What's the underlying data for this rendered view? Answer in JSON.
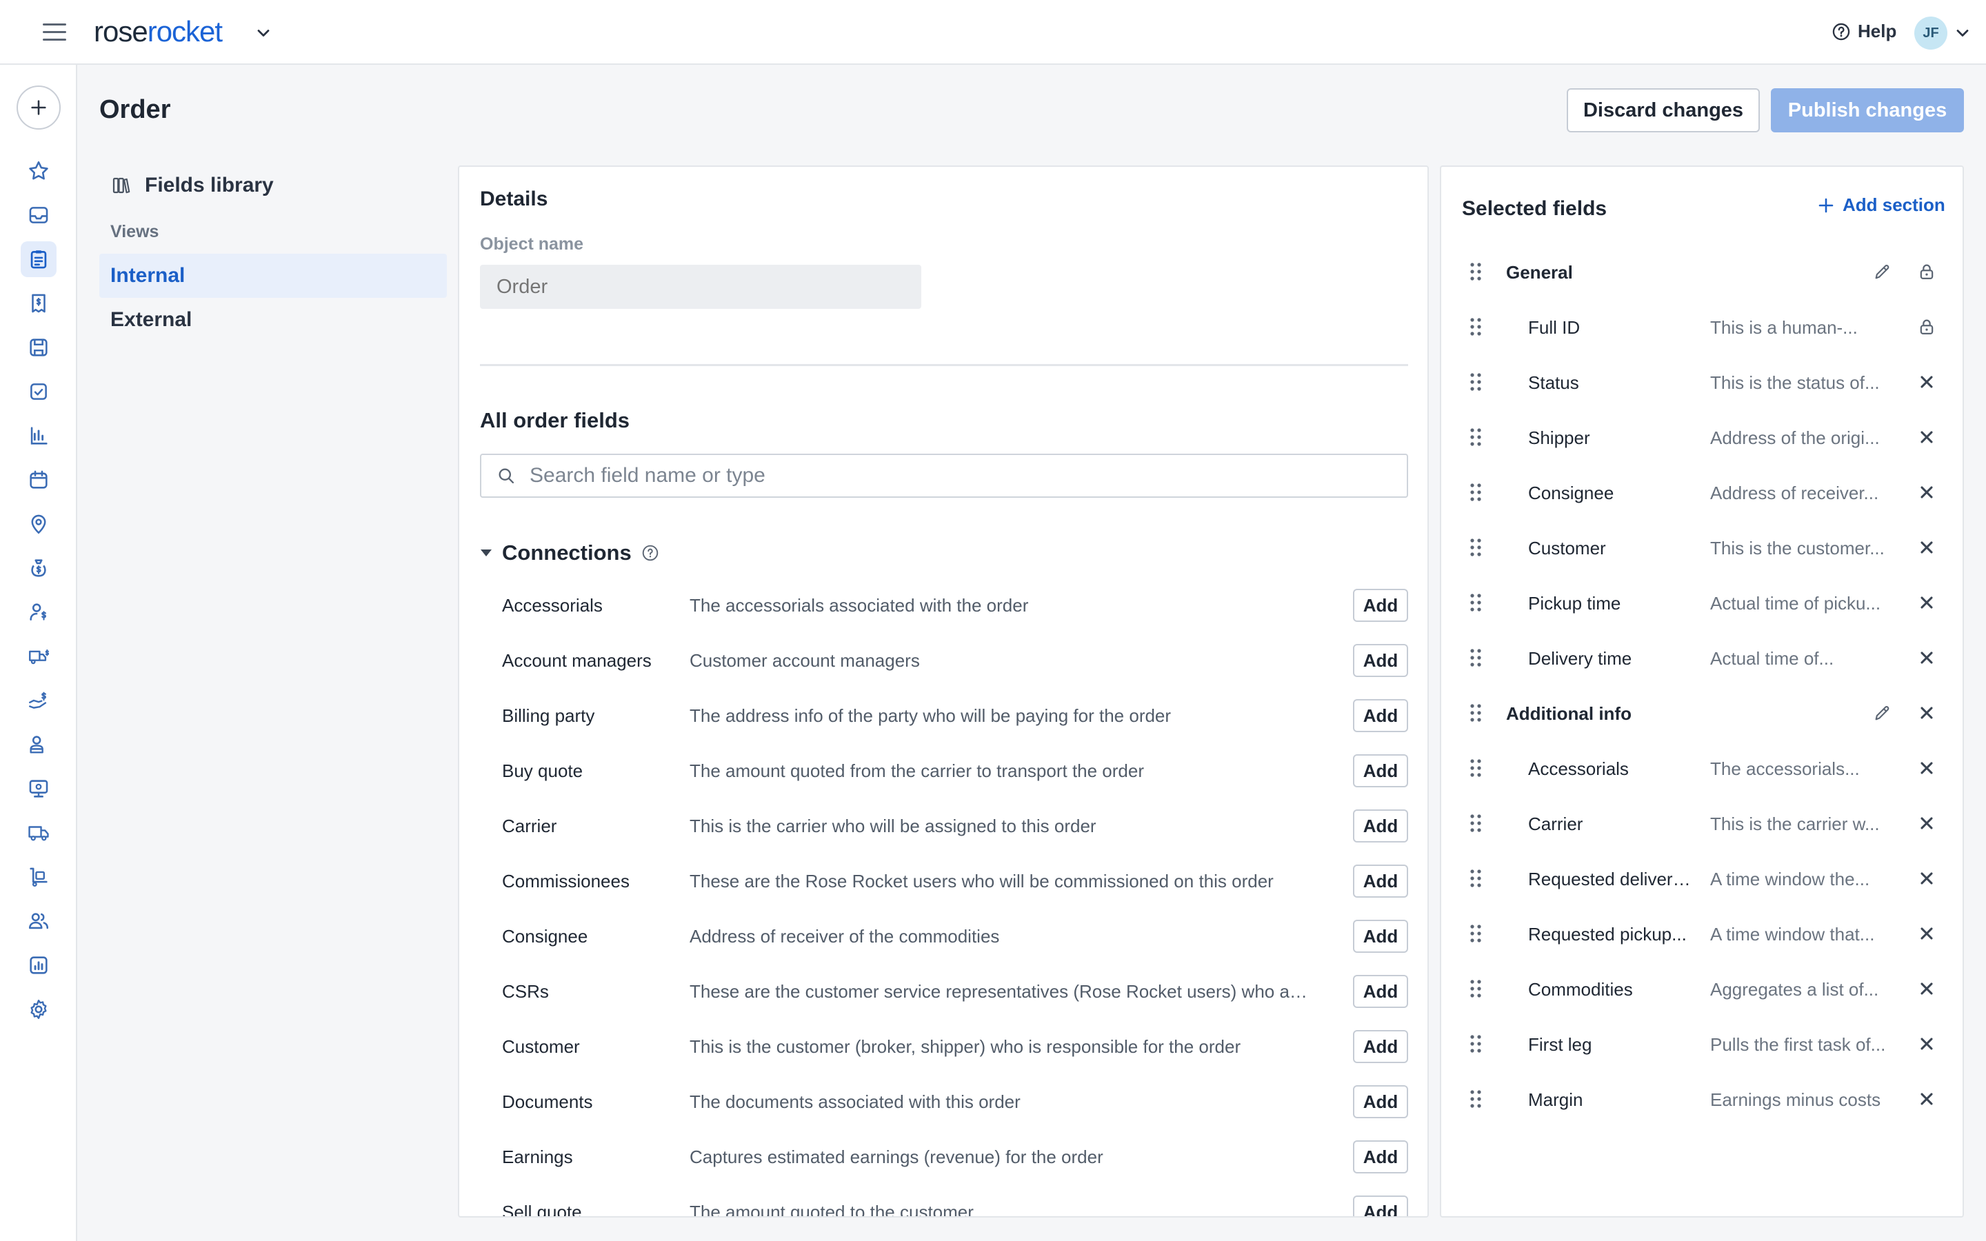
{
  "brand": {
    "name_part1": "rose",
    "name_part2": "rocket"
  },
  "header": {
    "help_label": "Help",
    "avatar_initials": "JF"
  },
  "page": {
    "title": "Order",
    "discard_label": "Discard changes",
    "publish_label": "Publish changes"
  },
  "library": {
    "title": "Fields library",
    "views_label": "Views",
    "views": [
      {
        "label": "Internal",
        "active": true
      },
      {
        "label": "External",
        "active": false
      }
    ]
  },
  "details": {
    "title": "Details",
    "object_name_label": "Object name",
    "object_name_placeholder": "Order"
  },
  "all_fields": {
    "title": "All order fields",
    "search_placeholder": "Search field name or type",
    "group_title": "Connections",
    "add_label": "Add",
    "rows": [
      {
        "name": "Accessorials",
        "desc": "The accessorials associated with the order"
      },
      {
        "name": "Account managers",
        "desc": "Customer account managers"
      },
      {
        "name": "Billing party",
        "desc": "The address info of the party who will be paying for the order"
      },
      {
        "name": "Buy quote",
        "desc": "The amount quoted from the carrier to transport the order"
      },
      {
        "name": "Carrier",
        "desc": "This is the carrier who will be assigned to this order"
      },
      {
        "name": "Commissionees",
        "desc": "These are the Rose Rocket users who will be commissioned on this order"
      },
      {
        "name": "Consignee",
        "desc": "Address of receiver of the commodities"
      },
      {
        "name": "CSRs",
        "desc": "These are the customer service representatives (Rose Rocket users) who are..."
      },
      {
        "name": "Customer",
        "desc": "This is the customer (broker, shipper) who is responsible for the order"
      },
      {
        "name": "Documents",
        "desc": "The documents associated with this order"
      },
      {
        "name": "Earnings",
        "desc": "Captures estimated earnings (revenue) for the order"
      },
      {
        "name": "Sell quote",
        "desc": "The amount quoted to the customer"
      }
    ]
  },
  "selected": {
    "title": "Selected fields",
    "add_section_label": "Add section",
    "sections": [
      {
        "name": "General",
        "fields": [
          {
            "name": "Full ID",
            "desc": "This is a human-...",
            "locked": true
          },
          {
            "name": "Status",
            "desc": "This is the status of...",
            "locked": false
          },
          {
            "name": "Shipper",
            "desc": "Address of the origi...",
            "locked": false
          },
          {
            "name": "Consignee",
            "desc": "Address of receiver...",
            "locked": false
          },
          {
            "name": "Customer",
            "desc": "This is the customer...",
            "locked": false
          },
          {
            "name": "Pickup time",
            "desc": "Actual time of picku...",
            "locked": false
          },
          {
            "name": "Delivery time",
            "desc": "Actual time of...",
            "locked": false
          }
        ]
      },
      {
        "name": "Additional info",
        "fields": [
          {
            "name": "Accessorials",
            "desc": "The accessorials...",
            "locked": false
          },
          {
            "name": "Carrier",
            "desc": "This is the carrier w...",
            "locked": false
          },
          {
            "name": "Requested delivery...",
            "desc": "A time window the...",
            "locked": false
          },
          {
            "name": "Requested pickup...",
            "desc": "A time window that...",
            "locked": false
          },
          {
            "name": "Commodities",
            "desc": "Aggregates a list of...",
            "locked": false
          },
          {
            "name": "First leg",
            "desc": "Pulls the first task of...",
            "locked": false
          },
          {
            "name": "Margin",
            "desc": "Earnings minus costs",
            "locked": false
          }
        ]
      }
    ]
  },
  "sidebar_icons": [
    "star-icon",
    "inbox-icon",
    "orders-icon",
    "invoice-icon",
    "save-icon",
    "checklist-icon",
    "reports-icon",
    "calendar-icon",
    "location-icon",
    "money-bag-icon",
    "person-dollar-icon",
    "truck-dollar-icon",
    "hand-dollar-icon",
    "user-list-icon",
    "dispatch-board-icon",
    "truck-icon",
    "dolly-icon",
    "users-icon",
    "analytics-icon",
    "settings-icon"
  ],
  "colors": {
    "accent": "#1b5fc7",
    "publish_disabled": "#8fb2e8",
    "active_bg": "#e8effb"
  }
}
